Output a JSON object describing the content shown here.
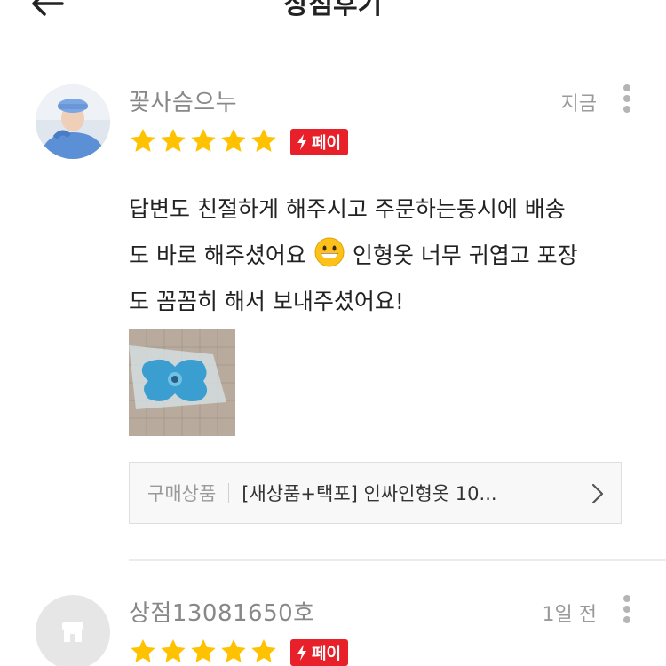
{
  "header": {
    "title": "상점후기"
  },
  "reviews": [
    {
      "name": "꽃사슴으누",
      "time": "지금",
      "rating": 5,
      "badge": "페이",
      "text_line1": "답변도 친절하게 해주시고 주문하는동시에 배송",
      "text_line2a": "도 바로 해주셨어요",
      "text_line2b": "인형옷 너무 귀엽고 포장",
      "text_line3": "도 꼼꼼히 해서 보내주셨어요!",
      "emoji": "grinning-face",
      "product_prefix": "구매상품",
      "product_name": "[새상품+택포] 인싸인형옷 10..."
    },
    {
      "name": "상점13081650호",
      "time": "1일 전",
      "rating": 5,
      "badge": "페이"
    }
  ],
  "colors": {
    "star": "#ffc200",
    "badge": "#e8202a",
    "muted_text": "#888888"
  }
}
